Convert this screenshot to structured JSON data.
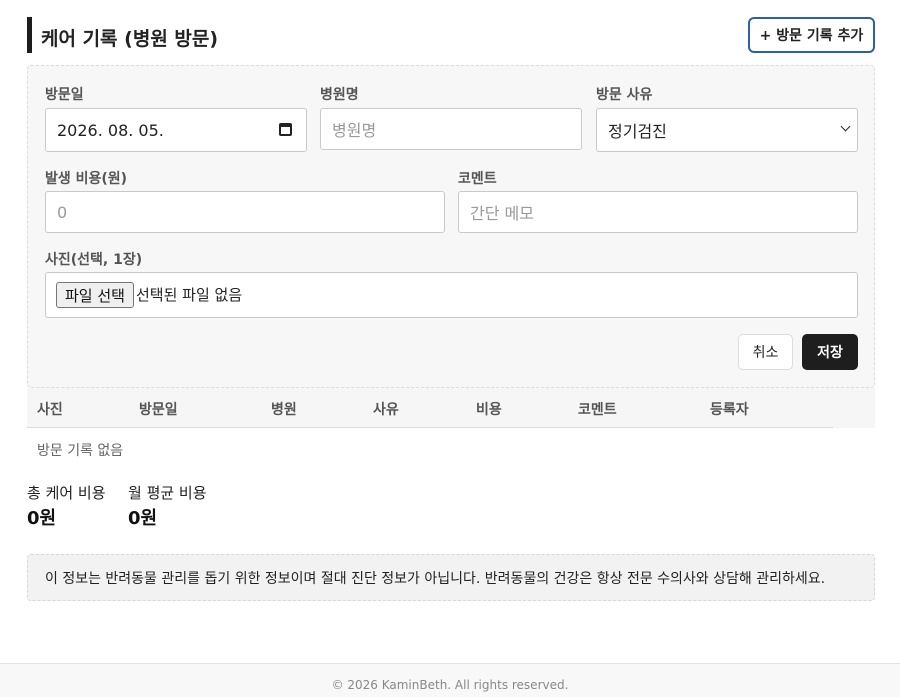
{
  "header": {
    "title": "케어 기록 (병원 방문)",
    "add_button_label": "+ 방문 기록 추가"
  },
  "form": {
    "visit_date_label": "방문일",
    "visit_date_value": "2026. 08. 05.",
    "hospital_label": "병원명",
    "hospital_placeholder": "병원명",
    "reason_label": "방문 사유",
    "reason_value": "정기검진",
    "cost_label": "발생 비용(원)",
    "cost_placeholder": "0",
    "comment_label": "코멘트",
    "comment_placeholder": "간단 메모",
    "photo_label": "사진(선택, 1장)",
    "file_button_label": "파일 선택",
    "file_status": "선택된 파일 없음",
    "cancel_label": "취소",
    "save_label": "저장"
  },
  "table": {
    "columns": [
      "사진",
      "방문일",
      "병원",
      "사유",
      "비용",
      "코멘트",
      "등록자"
    ],
    "empty_message": "방문 기록 없음"
  },
  "stats": {
    "total_label": "총 케어 비용",
    "total_value": "0원",
    "monthly_label": "월 평균 비용",
    "monthly_value": "0원"
  },
  "notice": "이 정보는 반려동물 관리를 돕기 위한 정보이며 절대 진단 정보가 아닙니다. 반려동물의 건강은 항상 전문 수의사와 상담해 관리하세요.",
  "footer": "© 2026 KaminBeth. All rights reserved.",
  "colors": {
    "accent_border": "#2e5fa8",
    "save_button": "#1e1e1e",
    "panel_bg": "#f7f7f7"
  }
}
